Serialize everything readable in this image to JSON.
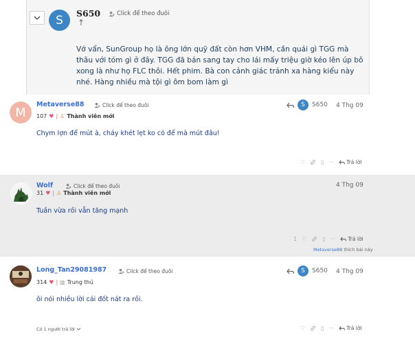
{
  "quote": {
    "avatar_letter": "S",
    "username": "S650",
    "follow_label": "Click để theo đuôi",
    "text": "Vớ vẩn, SunGroup họ là ông lớn quỹ đất còn hơn VHM, cần quái gì TGG mà thâu với tóm gì ở đây. TGG đã bán sang tay cho lái mấy triệu giờ kéo lên úp bô xong là như họ FLC thôi. Hết phim. Bà con cảnh giác tránh xa hàng kiểu này nhé. Hàng nhiều mà tội gì ôm bom làm gì"
  },
  "posts": [
    {
      "avatar_letter": "M",
      "avatar_color": "#f2b6a6",
      "username": "Metaverse88",
      "follow_label": "Click để theo đuôi",
      "likes": "107",
      "rank": "Thành viên mới",
      "reply_to_letter": "S",
      "reply_to_name": "S650",
      "date": "4 Thg 09",
      "body": "Chym lợn để mút à, cháy khét lẹt ko có để mà mút đâu!",
      "reply_label": "Trả lời"
    },
    {
      "username": "Wolf",
      "follow_label": "Click để theo đuôi",
      "likes": "31",
      "rank": "Thành viên mới",
      "date": "4 Thg 09",
      "body": "Tuần vừa rồi vẫn tăng mạnh",
      "like_count": "1",
      "reply_label": "Trả lời",
      "liked_by": "Metaverse88",
      "liked_suffix": "thích bài này"
    },
    {
      "username": "Long_Tan29081987",
      "follow_label": "Click để theo đuôi",
      "likes": "314",
      "rank": "Trung thủ",
      "reply_to_letter": "S",
      "reply_to_name": "S650",
      "date": "4 Thg 09",
      "body": "ôi nói nhiều lời cái đốt nát ra rồi.",
      "reply_label": "Trả lời",
      "more_replies": "Có 1 người trả lời"
    }
  ],
  "colors": {
    "link": "#3a6fd0",
    "avatar_blue": "#3d86c6",
    "heart": "#e05a7a"
  }
}
